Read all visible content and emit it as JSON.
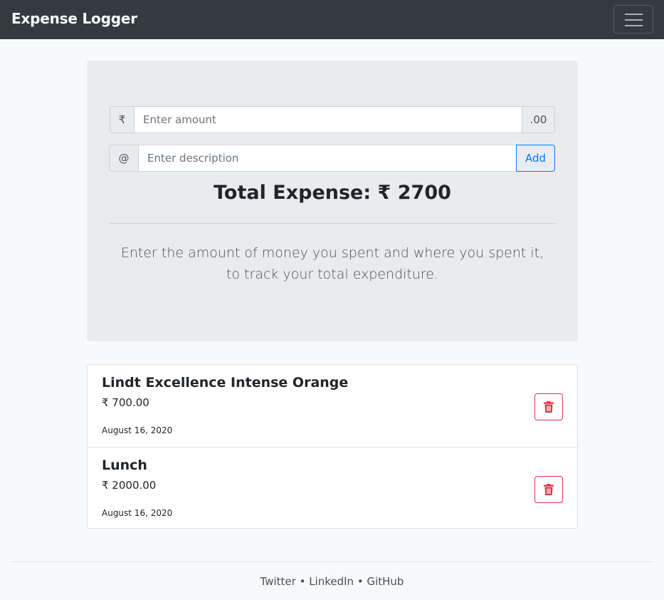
{
  "navbar": {
    "brand": "Expense Logger"
  },
  "form": {
    "currency_symbol": "₹",
    "amount_placeholder": "Enter amount",
    "amount_value": "",
    "decimal_suffix": ".00",
    "at_symbol": "@",
    "description_placeholder": "Enter description",
    "description_value": "",
    "add_label": "Add"
  },
  "summary": {
    "total_text": "Total Expense: ₹ 2700",
    "lead_text": "Enter the amount of money you spent and where you spent it, to track your total expenditure."
  },
  "expenses": [
    {
      "title": "Lindt Excellence Intense Orange",
      "amount": "₹ 700.00",
      "date": "August 16, 2020"
    },
    {
      "title": "Lunch",
      "amount": "₹ 2000.00",
      "date": "August 16, 2020"
    }
  ],
  "footer": {
    "links": [
      "Twitter",
      "LinkedIn",
      "GitHub"
    ],
    "separator": " • "
  },
  "colors": {
    "navbar": "#343a40",
    "primary": "#007bff",
    "danger": "#dc3545",
    "jumbotron": "#e9ecef"
  }
}
